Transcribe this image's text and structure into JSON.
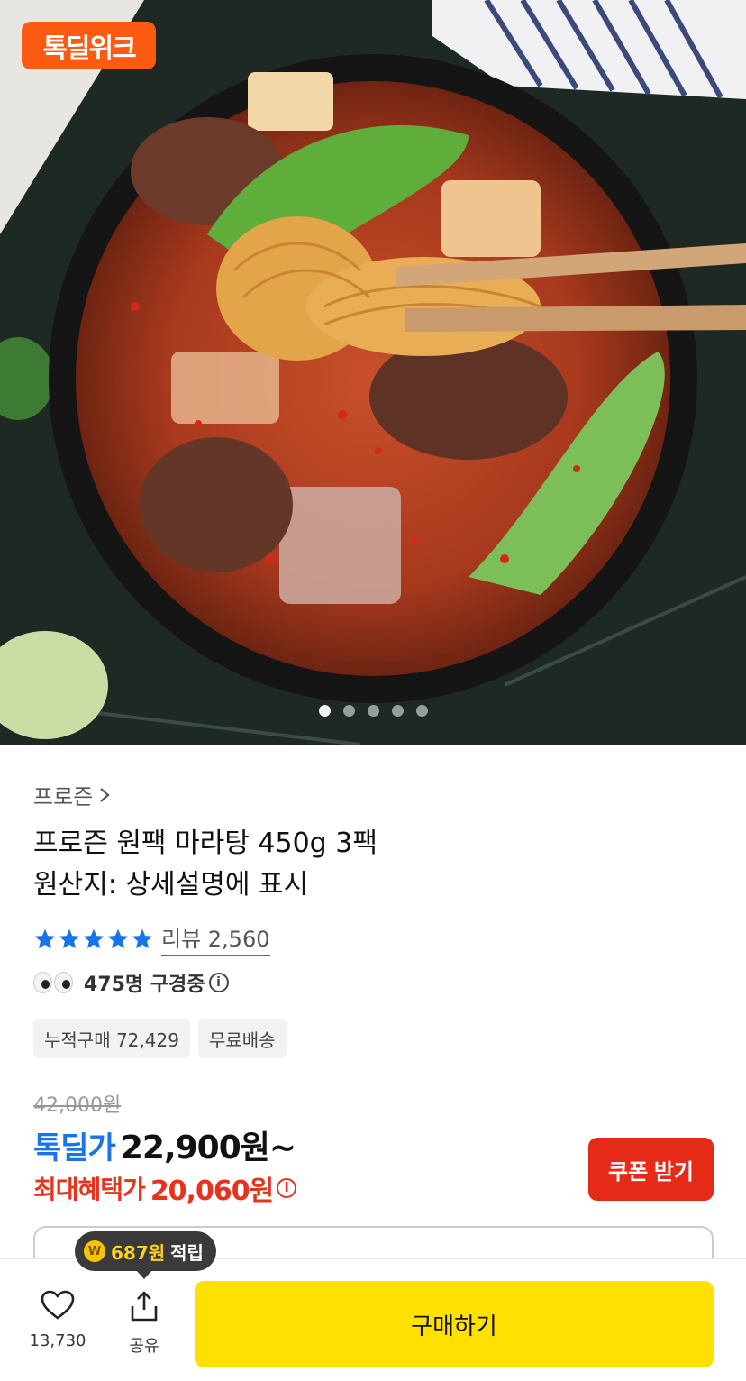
{
  "hero": {
    "brand_badge": "톡딜위크",
    "carousel_dots": 5,
    "active_dot": 0
  },
  "product": {
    "category": "프로즌",
    "category_chevron": "chevron-right-icon",
    "title": "프로즌 원팩 마라탕 450g 3팩",
    "origin": "원산지: 상세설명에 표시",
    "rating_stars": 5,
    "review_label": "리뷰 2,560",
    "viewers": "475명 구경중",
    "tags": [
      "누적구매 72,429",
      "무료배송"
    ]
  },
  "price": {
    "original": "42,000원",
    "deal_label": "톡딜가",
    "deal_price": "22,900원~",
    "max_label": "최대혜택가",
    "max_price": "20,060원",
    "coupon_button": "쿠폰 받기"
  },
  "tooltip": {
    "coin_symbol": "W",
    "amount": "687원",
    "text": "적립"
  },
  "bottom_bar": {
    "like_count": "13,730",
    "share_label": "공유",
    "buy_button": "구매하기"
  },
  "colors": {
    "brand_orange": "#ff5a12",
    "deal_blue": "#1a73e8",
    "benefit_red": "#e8321e",
    "buy_yellow": "#ffe100",
    "star_blue": "#1a73e8"
  }
}
